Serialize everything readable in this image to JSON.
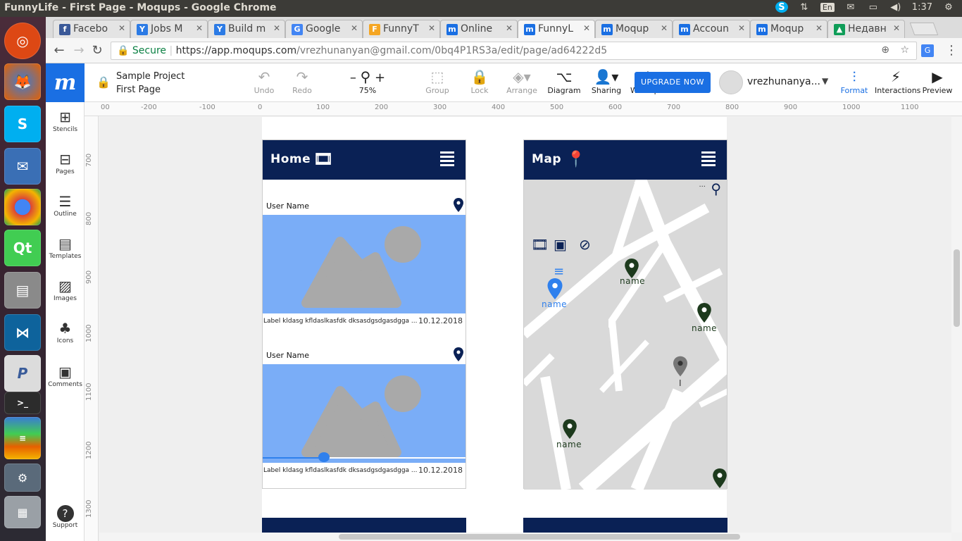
{
  "system": {
    "window_title": "FunnyLife - First Page - Moqups - Google Chrome",
    "language": "En",
    "clock": "1:37"
  },
  "browser": {
    "tabs": [
      {
        "label": "Facebo",
        "favicon_color": "#3b5998",
        "favicon": "f",
        "active": false
      },
      {
        "label": "Jobs M",
        "favicon_color": "#2c7be5",
        "favicon": "Y",
        "active": false
      },
      {
        "label": "Build m",
        "favicon_color": "#2c7be5",
        "favicon": "Y",
        "active": false
      },
      {
        "label": "Google",
        "favicon_color": "#4285f4",
        "favicon": "G",
        "active": false
      },
      {
        "label": "FunnyT",
        "favicon_color": "#f5a623",
        "favicon": "F",
        "active": false
      },
      {
        "label": "Online",
        "favicon_color": "#1a6fe3",
        "favicon": "m",
        "active": false
      },
      {
        "label": "FunnyL",
        "favicon_color": "#1a6fe3",
        "favicon": "m",
        "active": true
      },
      {
        "label": "Moqup",
        "favicon_color": "#1a6fe3",
        "favicon": "m",
        "active": false
      },
      {
        "label": "Accoun",
        "favicon_color": "#1a6fe3",
        "favicon": "m",
        "active": false
      },
      {
        "label": "Moqup",
        "favicon_color": "#1a6fe3",
        "favicon": "m",
        "active": false
      },
      {
        "label": "Недавн",
        "favicon_color": "#0f9d58",
        "favicon": "▲",
        "active": false
      }
    ],
    "secure_label": "Secure",
    "url_scheme_host": "https://app.moqups.com",
    "url_path": "/vrezhunanyan@gmail.com/0bq4P1RS3a/edit/page/ad64222d5"
  },
  "moqups": {
    "project_name": "Sample Project",
    "page_name": "First Page",
    "toolbar": {
      "undo": "Undo",
      "redo": "Redo",
      "zoom": "75%",
      "group": "Group",
      "lock": "Lock",
      "arrange": "Arrange",
      "diagram": "Diagram",
      "sharing": "Sharing",
      "workspace": "Workspace",
      "upgrade": "UPGRADE NOW",
      "username": "vrezhunanya...",
      "format": "Format",
      "interactions": "Interactions",
      "preview": "Preview"
    },
    "left_panel": [
      "Stencils",
      "Pages",
      "Outline",
      "Templates",
      "Images",
      "Icons",
      "Comments",
      "Support"
    ],
    "ruler_top": [
      "00",
      "-200",
      "-100",
      "0",
      "100",
      "200",
      "300",
      "400",
      "500",
      "600",
      "700",
      "800",
      "900",
      "1000",
      "1100"
    ],
    "ruler_left": [
      "700",
      "800",
      "900",
      "1000",
      "1100",
      "1200",
      "1300"
    ]
  },
  "home_screen": {
    "title": "Home",
    "posts": [
      {
        "user": "User Name",
        "caption": "Label kldasg kfldaslkasfdk dksasdgsdgasdgga ...",
        "date": "10.12.2018",
        "progress": 0.3
      },
      {
        "user": "User Name",
        "caption": "Label kldasg kfldaslkasfdk dksasdgsdgasdgga ...",
        "date": "10.12.2018"
      }
    ]
  },
  "map_screen": {
    "title": "Map",
    "search_hint": "...",
    "markers": [
      "name",
      "name",
      "name",
      "name",
      "I"
    ]
  },
  "colors": {
    "moqups_blue": "#1a6fe3",
    "app_navy": "#0a2155",
    "image_placeholder": "#7aadf7",
    "map_marker": "#1d3a1d"
  }
}
